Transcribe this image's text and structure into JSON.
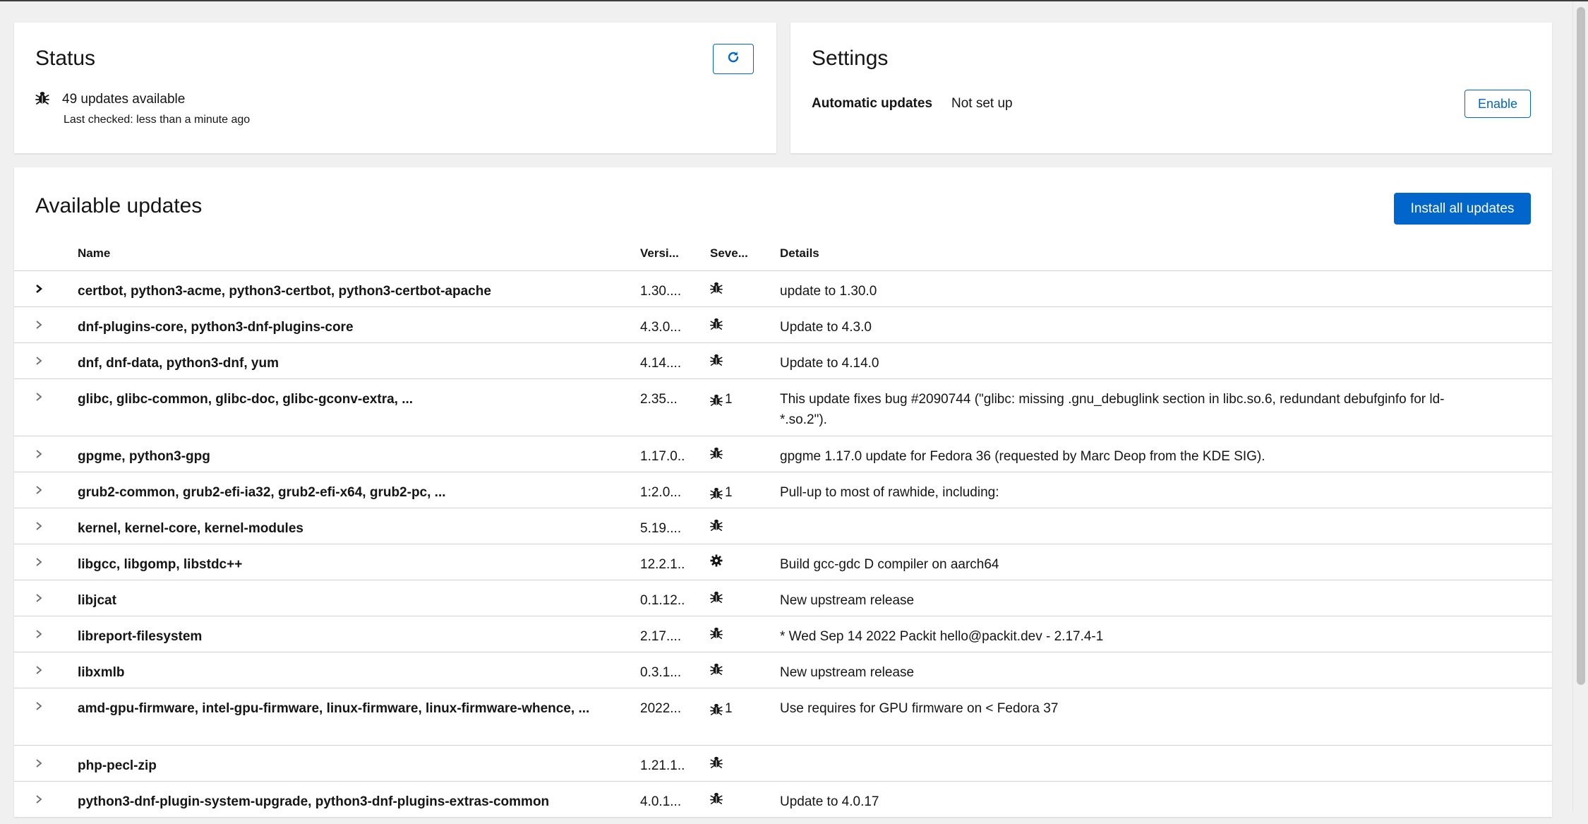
{
  "status": {
    "title": "Status",
    "updates_text": "49 updates available",
    "last_checked": "Last checked: less than a minute ago"
  },
  "settings": {
    "title": "Settings",
    "auto_label": "Automatic updates",
    "auto_value": "Not set up",
    "enable_label": "Enable"
  },
  "updates": {
    "title": "Available updates",
    "install_all_label": "Install all updates",
    "columns": {
      "name": "Name",
      "version": "Versi...",
      "severity": "Seve...",
      "details": "Details"
    },
    "rows": [
      {
        "name": "certbot, python3-acme, python3-certbot, python3-certbot-apache",
        "version": "1.30....",
        "severity_icon": "bug-icon",
        "severity_count": "",
        "details": "update to 1.30.0"
      },
      {
        "name": "dnf-plugins-core, python3-dnf-plugins-core",
        "version": "4.3.0...",
        "severity_icon": "bug-icon",
        "severity_count": "",
        "details": "Update to 4.3.0"
      },
      {
        "name": "dnf, dnf-data, python3-dnf, yum",
        "version": "4.14....",
        "severity_icon": "bug-icon",
        "severity_count": "",
        "details": "Update to 4.14.0"
      },
      {
        "name": "glibc, glibc-common, glibc-doc, glibc-gconv-extra, ...",
        "version": "2.35...",
        "severity_icon": "bug-icon",
        "severity_count": "1",
        "details": "This update fixes bug #2090744 (\"glibc: missing .gnu_debuglink section in libc.so.6, redundant debufginfo for ld-*.so.2\")."
      },
      {
        "name": "gpgme, python3-gpg",
        "version": "1.17.0...",
        "severity_icon": "bug-icon",
        "severity_count": "",
        "details": "gpgme 1.17.0 update for Fedora 36 (requested by Marc Deop from the KDE SIG)."
      },
      {
        "name": "grub2-common, grub2-efi-ia32, grub2-efi-x64, grub2-pc, ...",
        "version": "1:2.0...",
        "severity_icon": "bug-icon",
        "severity_count": "1",
        "details": "Pull-up to most of rawhide, including:"
      },
      {
        "name": "kernel, kernel-core, kernel-modules",
        "version": "5.19....",
        "severity_icon": "bug-icon",
        "severity_count": "",
        "details": ""
      },
      {
        "name": "libgcc, libgomp, libstdc++",
        "version": "12.2.1...",
        "severity_icon": "gear-icon",
        "severity_count": "",
        "details": "Build gcc-gdc D compiler on aarch64"
      },
      {
        "name": "libjcat",
        "version": "0.1.12...",
        "severity_icon": "bug-icon",
        "severity_count": "",
        "details": "New upstream release"
      },
      {
        "name": "libreport-filesystem",
        "version": "2.17....",
        "severity_icon": "bug-icon",
        "severity_count": "",
        "details": "* Wed Sep 14 2022 Packit hello@packit.dev - 2.17.4-1"
      },
      {
        "name": "libxmlb",
        "version": "0.3.1...",
        "severity_icon": "bug-icon",
        "severity_count": "",
        "details": "New upstream release"
      },
      {
        "name": "amd-gpu-firmware, intel-gpu-firmware, linux-firmware, linux-firmware-whence, ...",
        "version": "2022...",
        "severity_icon": "bug-icon",
        "severity_count": "1",
        "details": "Use requires for GPU firmware on < Fedora 37"
      },
      {
        "name": "php-pecl-zip",
        "version": "1.21.1...",
        "severity_icon": "bug-icon",
        "severity_count": "",
        "details": ""
      },
      {
        "name": "python3-dnf-plugin-system-upgrade, python3-dnf-plugins-extras-common",
        "version": "4.0.1...",
        "severity_icon": "bug-icon",
        "severity_count": "",
        "details": "Update to 4.0.17"
      }
    ]
  },
  "colors": {
    "accent": "#0066cc",
    "page_bg": "#f0f0f0",
    "card_bg": "#ffffff",
    "border": "#d2d2d2"
  }
}
